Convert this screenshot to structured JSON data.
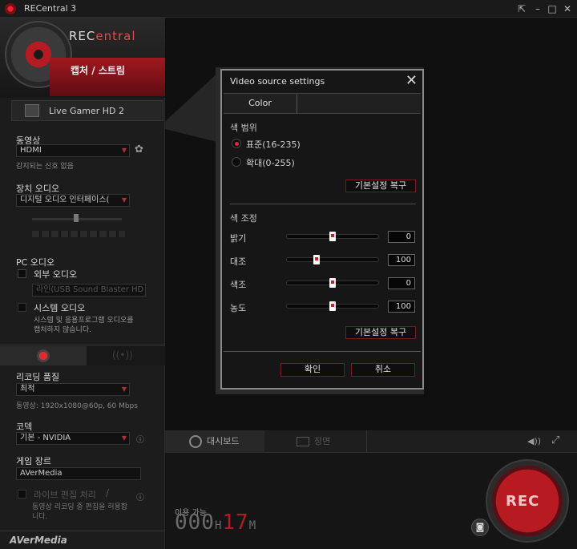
{
  "window": {
    "title": "RECentral 3"
  },
  "logo": {
    "text_a": "REC",
    "text_b": "entral"
  },
  "mode": {
    "label": "캡처 / 스트림"
  },
  "device": {
    "name": "Live Gamer HD 2"
  },
  "sidebar": {
    "video_label": "동영상",
    "video_source": "HDMI",
    "video_status": "감지되는 신호 없음",
    "device_audio_label": "장치 오디오",
    "device_audio_value": "디지털 오디오 인터페이스(",
    "pc_audio_label": "PC 오디오",
    "external_audio_label": "외부 오디오",
    "external_audio_value": "라인(USB Sound Blaster HD",
    "system_audio_label": "시스템 오디오",
    "system_audio_desc_1": "시스템 및 응용프로그램 오디오를",
    "system_audio_desc_2": "캡처하지 않습니다.",
    "quality_label": "리코딩 품질",
    "quality_value": "최적",
    "quality_desc": "동영상: 1920x1080@60p, 60 Mbps",
    "codec_label": "코덱",
    "codec_value": "기본 - NVIDIA",
    "game_genre_label": "게임 장르",
    "game_genre_value": "AVerMedia",
    "live_edit_label": "라이브 편집 처리",
    "live_edit_desc_1": "동영상 리코딩 중 편집을 허용합",
    "live_edit_desc_2": "니다.",
    "brand": "AVerMedia"
  },
  "bottom": {
    "tab_dashboard": "대시보드",
    "tab_scene": "장면",
    "available_label": "이용 가능",
    "timer_a": "000",
    "timer_h": "H",
    "timer_b": "17",
    "timer_m": "M",
    "rec_label": "REC"
  },
  "dialog": {
    "title": "Video source settings",
    "tab_color": "Color",
    "color_range_label": "색 범위",
    "range_options": [
      {
        "label": "표준(16-235)",
        "selected": true
      },
      {
        "label": "확대(0-255)",
        "selected": false
      }
    ],
    "reset_label": "기본설정 복구",
    "color_adjust_label": "색 조정",
    "adjustments": [
      {
        "label": "밝기",
        "value": "0",
        "fraction": 0.5
      },
      {
        "label": "대조",
        "value": "100",
        "fraction": 0.33
      },
      {
        "label": "색조",
        "value": "0",
        "fraction": 0.5
      },
      {
        "label": "농도",
        "value": "100",
        "fraction": 0.5
      }
    ],
    "ok_label": "확인",
    "cancel_label": "취소"
  },
  "colors": {
    "accent": "#b81a22",
    "dialog_border": "#8a8a8a"
  }
}
